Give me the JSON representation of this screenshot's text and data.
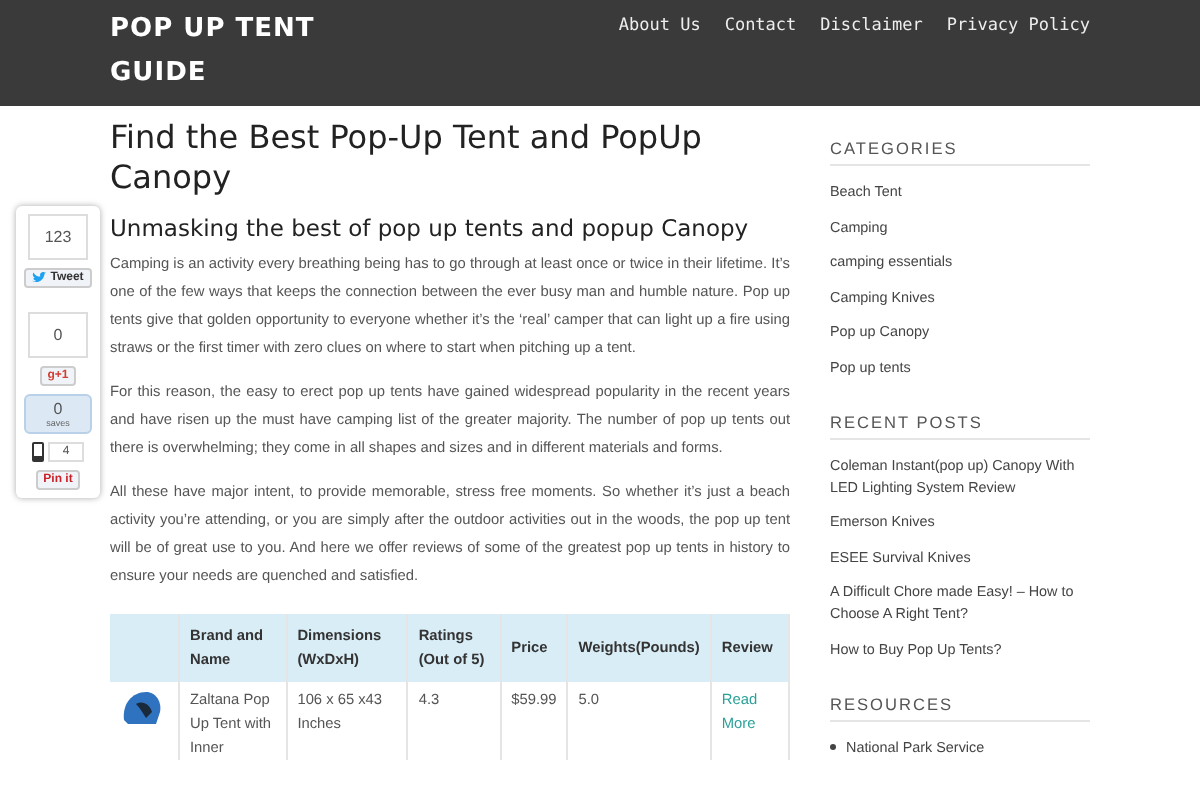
{
  "site": {
    "title": "POP UP TENT GUIDE"
  },
  "nav": [
    "About Us",
    "Contact",
    "Disclaimer",
    "Privacy Policy"
  ],
  "share": {
    "tweet_count": "123",
    "tweet": "Tweet",
    "plus_count": "0",
    "plus": "g+1",
    "saves_count": "0",
    "saves": "saves",
    "bookmarks": "4",
    "pin": "Pin it"
  },
  "article": {
    "title": "Find the Best Pop-Up Tent and PopUp Canopy",
    "subtitle": "Unmasking the best of pop up tents and popup Canopy",
    "paragraphs": [
      "Camping is an activity every breathing being has to go through at least once or twice in their lifetime. It’s one of the few ways that keeps the connection between the ever busy man and humble nature. Pop up tents give that golden opportunity to everyone whether it’s the ‘real’ camper that can light up a fire using straws or the first timer with zero clues on where to start when pitching up a tent.",
      "For this reason, the easy to erect pop up tents have gained widespread popularity in the recent years and have risen up the must have camping list of the greater majority. The number of pop up tents out there is overwhelming; they come in all shapes and sizes and in different materials and forms.",
      "All these have major intent, to provide memorable, stress free moments. So whether it’s just a beach activity you’re attending, or you are simply after the outdoor activities out in the woods, the pop up tent will be of great use to you. And here we offer reviews of some of the greatest pop up tents in history to ensure your needs are quenched and satisfied."
    ],
    "table": {
      "columns": [
        "Brand and Name",
        "Dimensions (WxDxH)",
        "Ratings (Out of 5)",
        "Price",
        "Weights(Pounds)",
        "Review"
      ],
      "rows": [
        {
          "name": "Zaltana Pop Up Tent with Inner",
          "dimensions": "106 x 65 x43 Inches",
          "rating": "4.3",
          "price": "$59.99",
          "weight": "5.0",
          "review": "Read More"
        }
      ]
    }
  },
  "sidebar": [
    {
      "heading": "CATEGORIES",
      "kind": "links",
      "items": [
        "Beach Tent",
        "Camping",
        "camping essentials",
        "Camping Knives",
        "Pop up Canopy",
        "Pop up tents"
      ]
    },
    {
      "heading": "RECENT POSTS",
      "kind": "links",
      "items": [
        "Coleman Instant(pop up) Canopy With LED Lighting System Review",
        "Emerson Knives",
        "ESEE Survival Knives",
        "A Difficult Chore made Easy! – How to Choose A Right Tent?",
        "How to Buy Pop Up Tents?"
      ]
    },
    {
      "heading": "RESOURCES",
      "kind": "bullets",
      "items": [
        "National Park Service"
      ]
    }
  ]
}
